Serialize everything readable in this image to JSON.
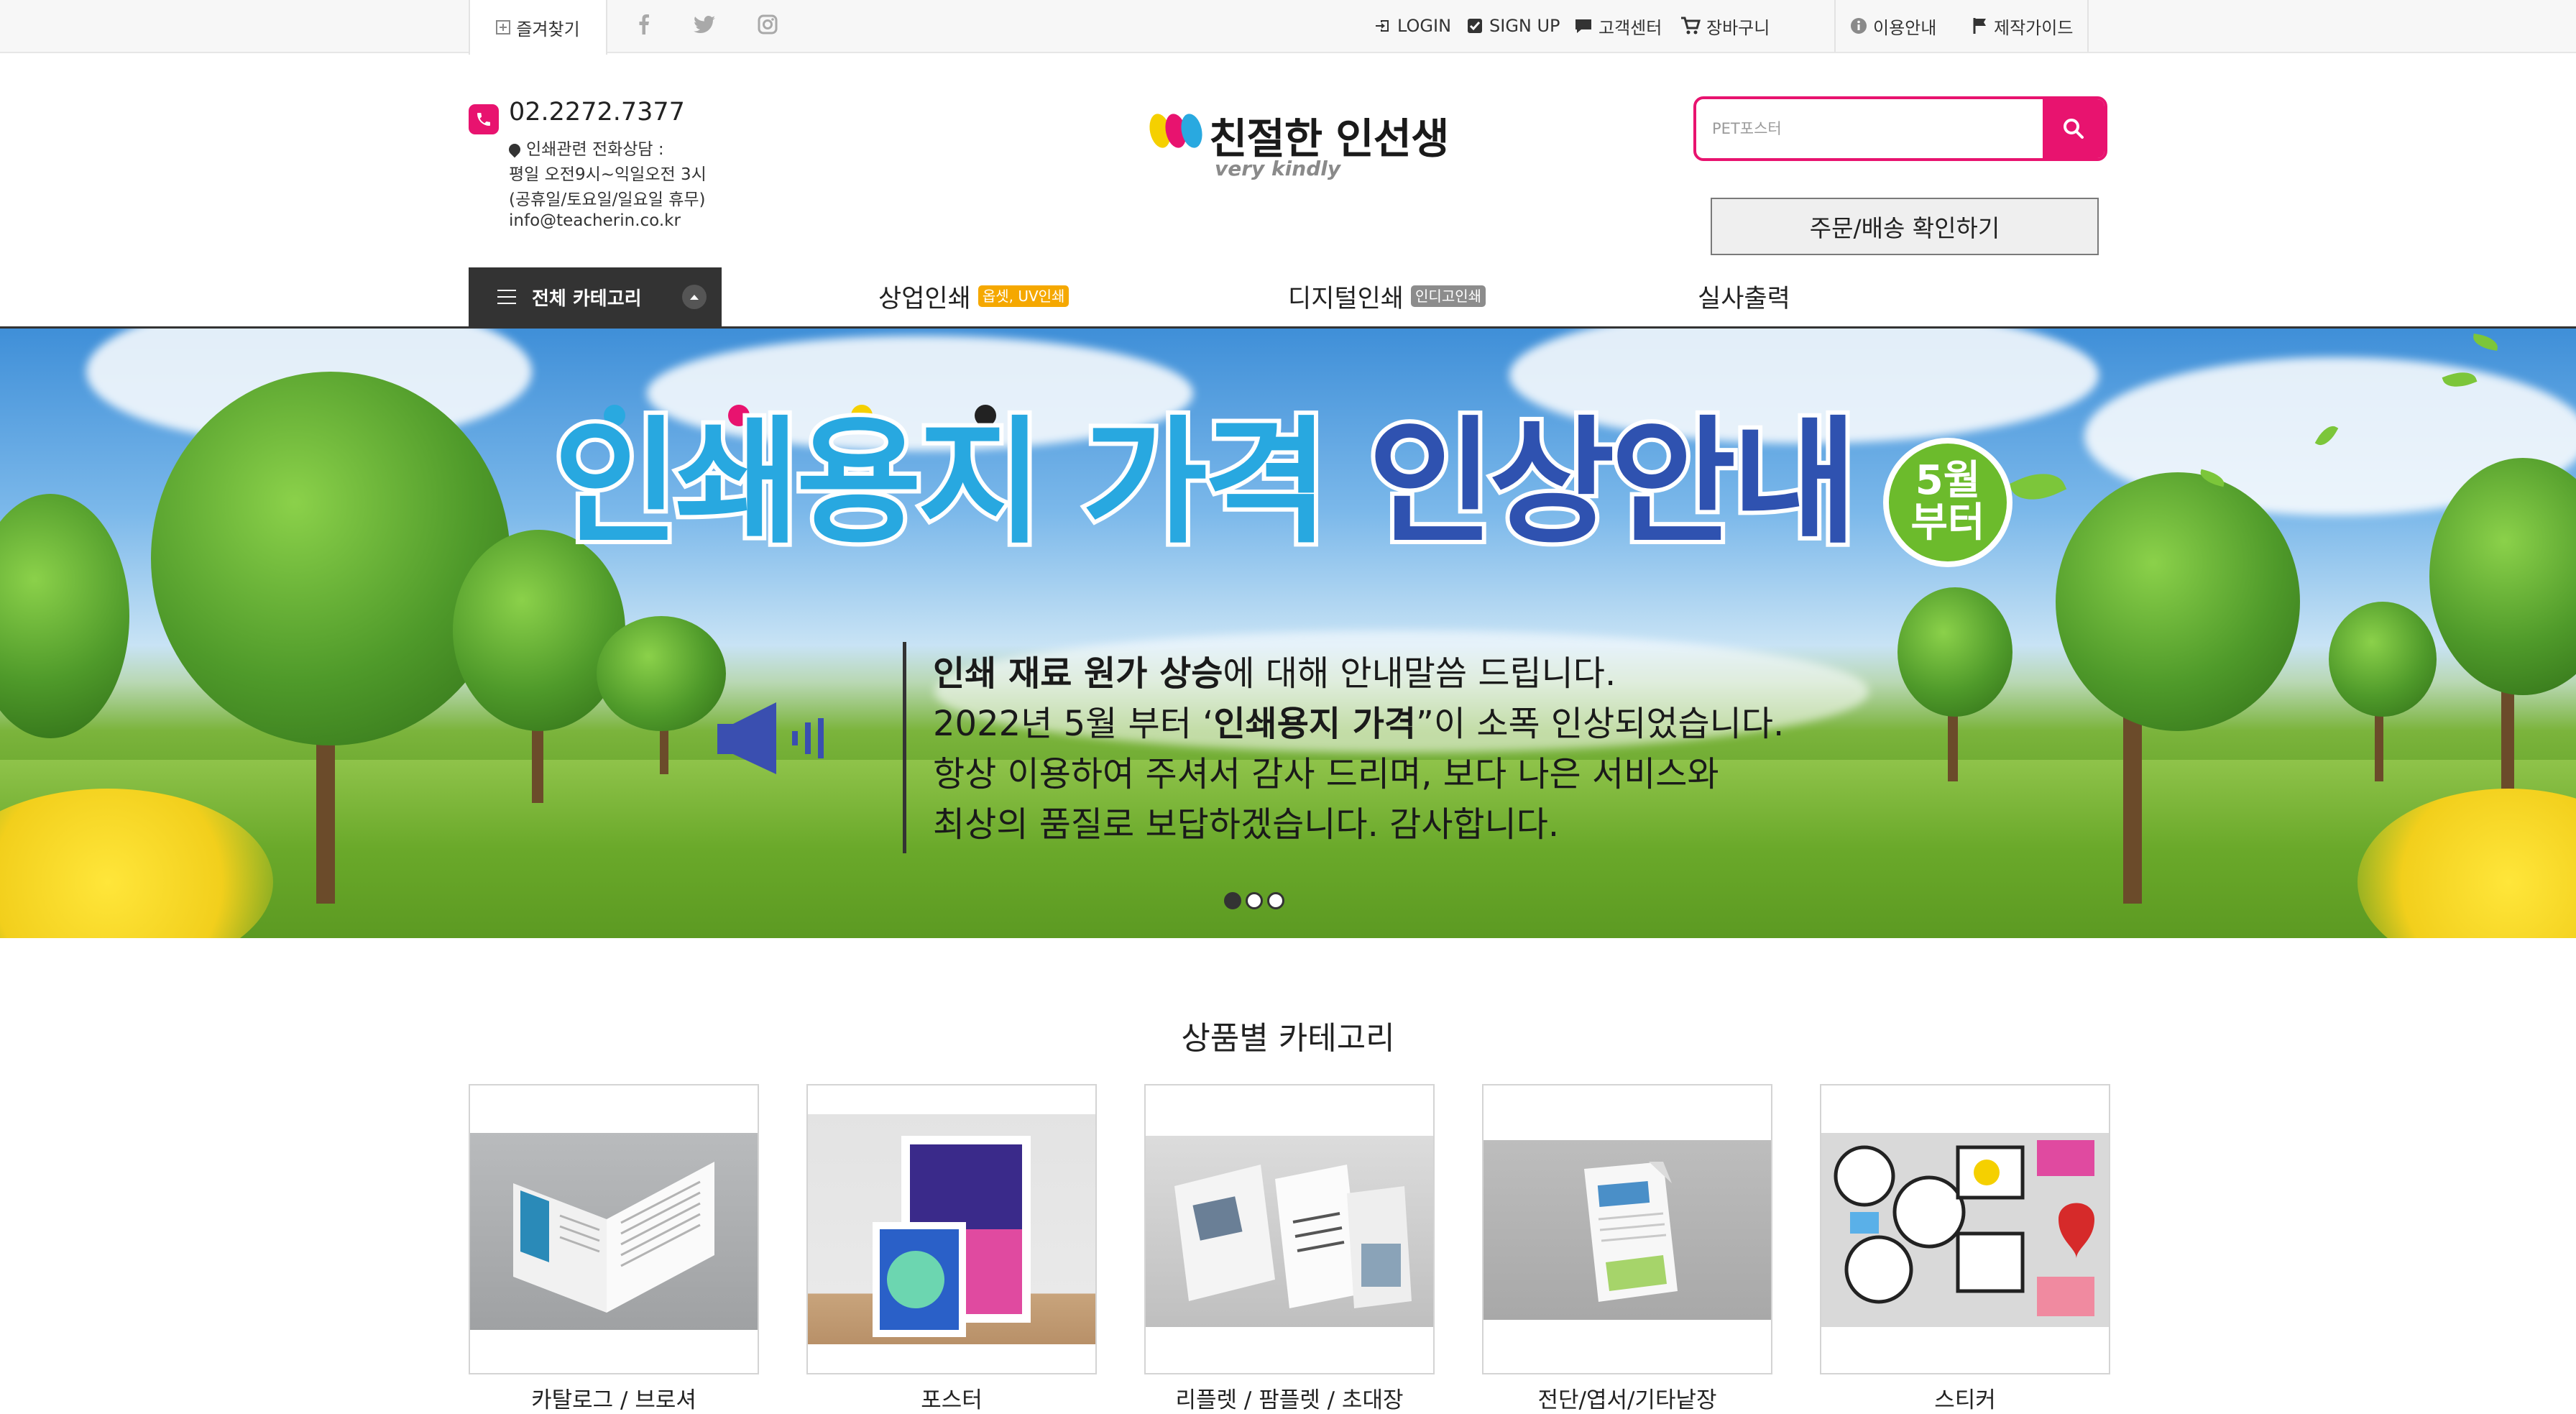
{
  "topbar": {
    "bookmark": "즐겨찾기",
    "social": [
      "facebook-icon",
      "twitter-icon",
      "instagram-icon"
    ],
    "links": {
      "login": "LOGIN",
      "signup": "SIGN UP",
      "support": "고객센터",
      "cart": "장바구니",
      "guide": "이용안내",
      "production": "제작가이드"
    }
  },
  "header": {
    "phone": "02.2272.7377",
    "info": [
      "인쇄관련 전화상담 :",
      "평일 오전9시~익일오전 3시",
      "(공휴일/토요일/일요일 휴무)",
      "info@teacherin.co.kr"
    ],
    "logo_text": "친절한 인선생",
    "logo_sub": "very kindly",
    "search_placeholder": "PET포스터",
    "order_button": "주문/배송 확인하기"
  },
  "nav": {
    "all_categories": "전체 카테고리",
    "items": [
      {
        "label": "상업인쇄",
        "badge": "옵셋, UV인쇄",
        "badge_color": "#f5a800"
      },
      {
        "label": "디지털인쇄",
        "badge": "인디고인쇄",
        "badge_color": "#8c8c8c"
      },
      {
        "label": "실사출력",
        "badge": "",
        "badge_color": ""
      }
    ]
  },
  "banner": {
    "title_part1": "인쇄용지 가격",
    "title_part2": "인상안내",
    "badge_line1": "5월",
    "badge_line2": "부터",
    "line1_bold": "인쇄 재료 원가 상승",
    "line1_rest": "에 대해 안내말씀 드립니다.",
    "line2_pre": "2022년 5월 부터 ‘",
    "line2_bold": "인쇄용지 가격",
    "line2_post": "”이 소폭 인상되었습니다.",
    "line3": "항상 이용하여 주셔서 감사 드리며, 보다 나은 서비스와",
    "line4": "최상의 품질로 보답하겠습니다. 감사합니다.",
    "dot_colors": [
      "#29a9e0",
      "#e8136f",
      "#f5d000",
      "#222222"
    ],
    "slide_count": 3,
    "active_slide": 1
  },
  "categories": {
    "title": "상품별 카테고리",
    "items": [
      "카탈로그 / 브로셔",
      "포스터",
      "리플렛 / 팜플렛 / 초대장",
      "전단/엽서/기타낱장",
      "스티커"
    ]
  },
  "colors": {
    "accent": "#e8136f",
    "nav_dark": "#333333"
  }
}
